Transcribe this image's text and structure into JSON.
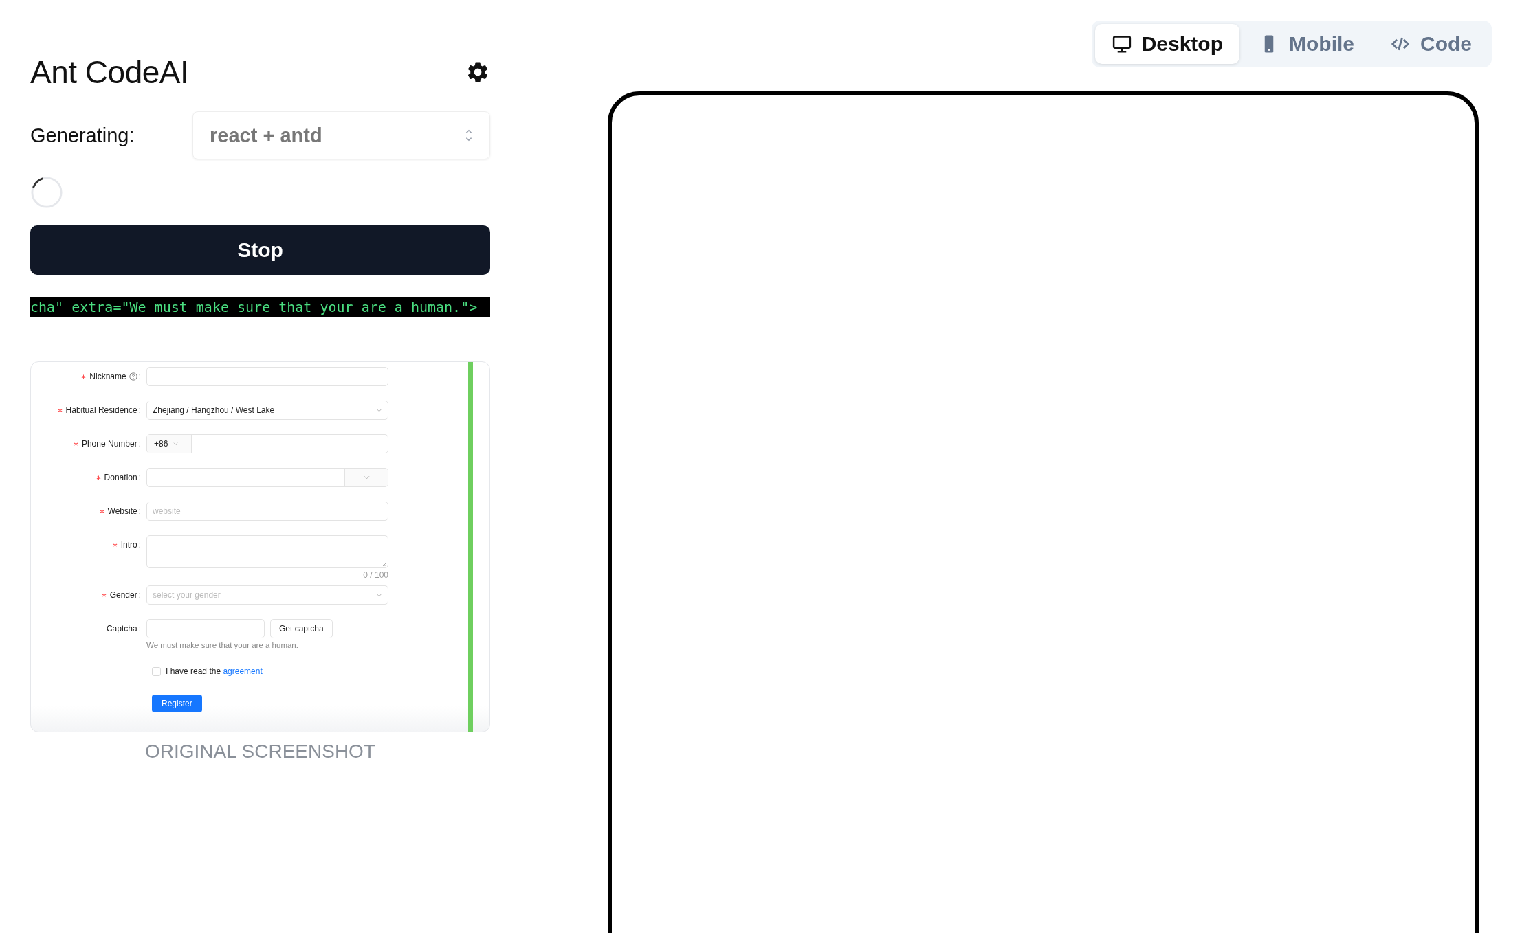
{
  "app": {
    "title": "Ant CodeAI"
  },
  "generating": {
    "label": "Generating:",
    "value": "react + antd",
    "loading": true
  },
  "stop_button": "Stop",
  "code_stream": "cha\" extra=\"We must make sure that your are a human.\">",
  "original_screenshot": {
    "caption": "ORIGINAL SCREENSHOT",
    "form": {
      "colon": ":",
      "fields": [
        {
          "kind": "input",
          "label": "Nickname",
          "required": true,
          "help": true
        },
        {
          "kind": "select",
          "label": "Habitual Residence",
          "required": true,
          "help": false,
          "value": "Zhejiang / Hangzhou / West Lake"
        },
        {
          "kind": "phone",
          "label": "Phone Number",
          "required": true,
          "help": false,
          "prefix": "+86"
        },
        {
          "kind": "donation",
          "label": "Donation",
          "required": true,
          "help": false
        },
        {
          "kind": "input",
          "label": "Website",
          "required": true,
          "help": false,
          "placeholder": "website"
        },
        {
          "kind": "textarea",
          "label": "Intro",
          "required": true,
          "help": false,
          "counter": "0 / 100"
        },
        {
          "kind": "select",
          "label": "Gender",
          "required": true,
          "help": false,
          "placeholder": "select your gender"
        },
        {
          "kind": "captcha",
          "label": "Captcha",
          "required": false,
          "help": false,
          "button": "Get captcha",
          "extra": "We must make sure that your are a human."
        }
      ],
      "agreement": {
        "text": "I have read the",
        "link": "agreement",
        "checked": false
      },
      "submit": "Register"
    }
  },
  "view_tabs": [
    {
      "label": "Desktop",
      "selected": true
    },
    {
      "label": "Mobile",
      "selected": false
    },
    {
      "label": "Code",
      "selected": false
    }
  ]
}
